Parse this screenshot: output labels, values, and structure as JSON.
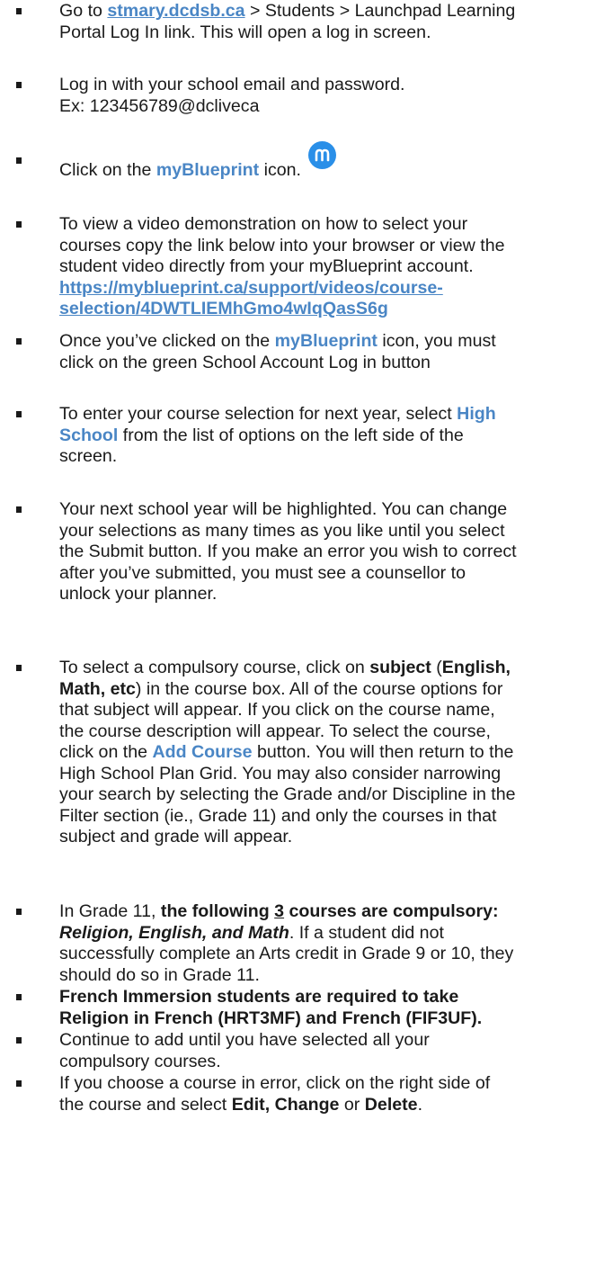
{
  "instructions": [
    {
      "line1_pre": "Go to ",
      "line1_link": "stmary.dcdsb.ca",
      "line1_post": " > Students > Launchpad Learning",
      "line2": "Portal Log In link. This will open a log in screen."
    },
    {
      "line1": "Log in with your school email and password.",
      "line2": "Ex: 123456789@dcliveca"
    },
    {
      "pre": "Click on the ",
      "brand": "myBlueprint",
      "post": " icon.",
      "icon": "myblueprint-logo-icon"
    },
    {
      "line1": "To view a video demonstration on how to select your",
      "line2": "courses copy the link below into your browser or view the",
      "line3": "student video directly from your myBlueprint account.",
      "url_line1": "https://myblueprint.ca/support/videos/course-",
      "url_line2": "selection/4DWTLIEMhGmo4wIqQasS6g"
    },
    {
      "pre": "Once you’ve clicked on the ",
      "brand": "myBlueprint",
      "post": " icon, you must",
      "line2": "click on the green School Account Log in button"
    },
    {
      "line1_pre": "To enter your course selection for next year, select ",
      "line1_hl": "High",
      "line2_hl": "School",
      "line2_post": " from the list of options on the left side of the",
      "line3": "screen."
    },
    {
      "line1": "Your next school year will be highlighted. You can change",
      "line2": "your selections as many times as you like until you select",
      "line3": "the Submit button. If you make an error you wish to correct",
      "line4": "after you’ve submitted, you must see a counsellor to",
      "line5": "unlock your planner."
    },
    {
      "l1_a": "To select a compulsory course, click on ",
      "l1_b": "subject",
      "l1_c": " (",
      "l1_d": "English,",
      "l2_a": "Math, etc",
      "l2_b": ") in the course box. All of the course options for",
      "line3": "that subject will appear. If you click on the course name,",
      "line4": "the course description will appear. To select the course,",
      "l5_a": "click on the ",
      "l5_b": "Add Course",
      "l5_c": " button. You will then return to the",
      "line6": "High School Plan Grid. You may also consider narrowing",
      "line7": "your search by selecting the Grade and/or Discipline in the",
      "line8": "Filter section (ie., Grade 11) and only the courses in that",
      "line9": "subject and grade will appear."
    },
    {
      "l1_a": "In Grade 11, ",
      "l1_b": "the following ",
      "l1_c": "3",
      "l1_d": " courses are compulsory:",
      "l2_a": "Religion, English, and Math",
      "l2_b": ".  If a student did not",
      "line3": "successfully complete an Arts credit in Grade 9 or 10, they",
      "line4": "should do so in Grade 11."
    },
    {
      "line1": "French Immersion students are required to take",
      "line2": "Religion in French (HRT3MF) and French (FIF3UF)."
    },
    {
      "line1": "Continue to add until you have selected all your",
      "line2": "compulsory courses."
    },
    {
      "line1": "If you choose a course in error, click on the right side of",
      "l2_a": "the course and select ",
      "l2_b": "Edit, Change",
      "l2_c": " or ",
      "l2_d": "Delete",
      "l2_e": "."
    }
  ]
}
